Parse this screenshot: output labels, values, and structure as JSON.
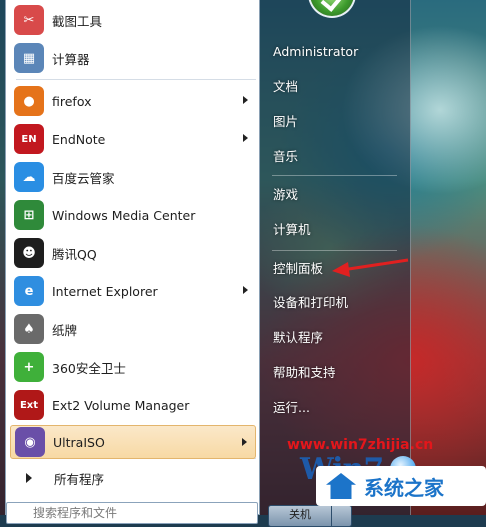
{
  "programs": [
    {
      "label": "截图工具",
      "icon": "scissors-icon",
      "color": "#d84a4a",
      "glyph": "✂",
      "submenu": false
    },
    {
      "label": "计算器",
      "icon": "calculator-icon",
      "color": "#5b86b8",
      "glyph": "▦",
      "submenu": false
    },
    {
      "label": "firefox",
      "icon": "firefox-icon",
      "color": "#e5731a",
      "glyph": "●",
      "submenu": true
    },
    {
      "label": "EndNote",
      "icon": "endnote-icon",
      "color": "#c2181f",
      "glyph": "EN",
      "submenu": true
    },
    {
      "label": "百度云管家",
      "icon": "baidu-cloud-icon",
      "color": "#2a8ee3",
      "glyph": "☁",
      "submenu": false
    },
    {
      "label": "Windows Media Center",
      "icon": "media-center-icon",
      "color": "#2f8a3a",
      "glyph": "⊞",
      "submenu": false
    },
    {
      "label": "腾讯QQ",
      "icon": "qq-penguin-icon",
      "color": "#1e1e1e",
      "glyph": "☻",
      "submenu": false
    },
    {
      "label": "Internet Explorer",
      "icon": "internet-explorer-icon",
      "color": "#2f8ee0",
      "glyph": "e",
      "submenu": true
    },
    {
      "label": "纸牌",
      "icon": "solitaire-cards-icon",
      "color": "#6a6a6a",
      "glyph": "♠",
      "submenu": false
    },
    {
      "label": "360安全卫士",
      "icon": "360-security-icon",
      "color": "#3fb03a",
      "glyph": "+",
      "submenu": false
    },
    {
      "label": "Ext2 Volume Manager",
      "icon": "ext2-icon",
      "color": "#b01818",
      "glyph": "Ext",
      "submenu": false
    },
    {
      "label": "UltraISO",
      "icon": "ultraiso-disc-icon",
      "color": "#6a4fa8",
      "glyph": "◉",
      "submenu": true
    }
  ],
  "all_programs": "所有程序",
  "search_placeholder": "搜索程序和文件",
  "right_links": [
    "Administrator",
    "文档",
    "图片",
    "音乐",
    "游戏",
    "计算机",
    "控制面板",
    "设备和打印机",
    "默认程序",
    "帮助和支持",
    "运行..."
  ],
  "shutdown_label": "关机",
  "watermark": {
    "url": "www.win7zhijia.cn",
    "brand": "系统之家",
    "win7": "Win7"
  },
  "colors": {
    "annotation_arrow": "#e02020",
    "selected_bg": "#f7d9a4"
  }
}
